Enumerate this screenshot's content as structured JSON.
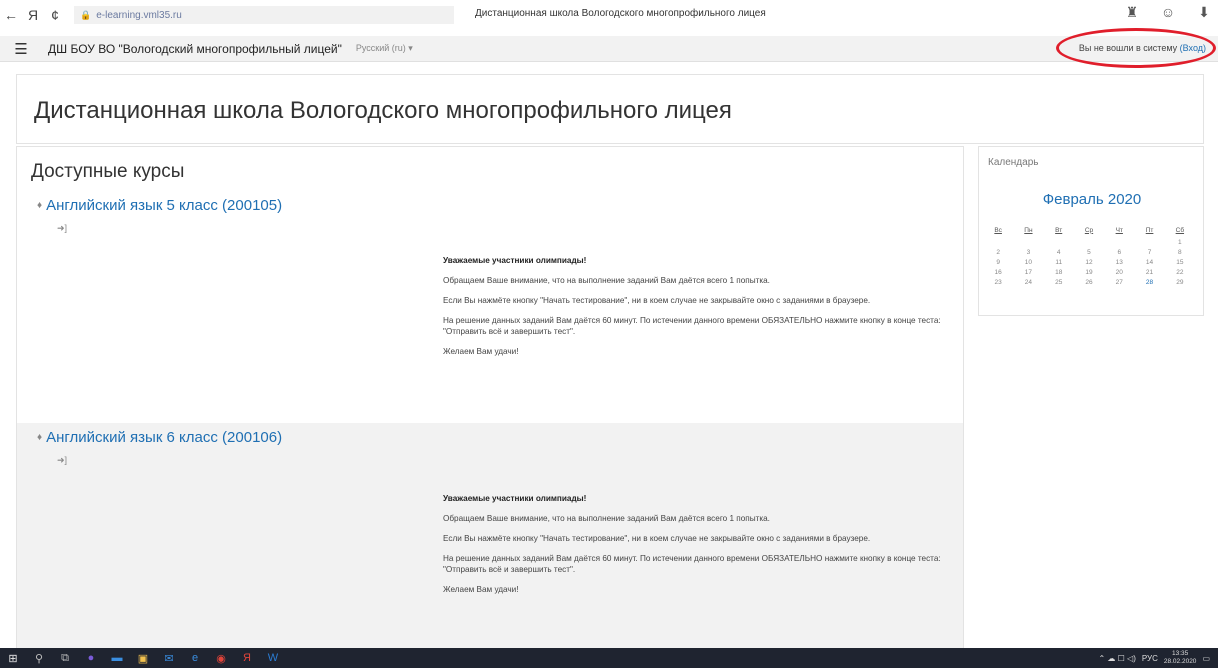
{
  "browser": {
    "back_icon": "←",
    "yandex_icon": "Я",
    "reload_icon": "¢",
    "url": "e-learning.vml35.ru",
    "tab_title": "Дистанционная школа Вологодского многопрофильного лицея",
    "bookmark_icon": "♜",
    "protect_icon": "☺",
    "download_icon": "⬇"
  },
  "navbar": {
    "site_name": "ДШ БОУ ВО \"Вологодский многопрофильный лицей\"",
    "language": "Русский (ru) ▾",
    "login_status": "Вы не вошли в систему",
    "login_link": "(Вход)"
  },
  "header": {
    "title": "Дистанционная школа Вологодского многопрофильного лицея"
  },
  "main": {
    "section_title": "Доступные курсы",
    "courses": [
      {
        "name": "Английский язык 5 класс (200105)",
        "summary_heading": "Уважаемые участники олимпиады!",
        "p1": "Обращаем Ваше внимание, что на выполнение заданий Вам даётся всего 1 попытка.",
        "p2": "Если Вы нажмёте кнопку \"Начать тестирование\", ни в коем случае не закрывайте окно с заданиями в браузере.",
        "p3": "На решение данных заданий Вам даётся 60 минут. По истечении данного времени ОБЯЗАТЕЛЬНО нажмите кнопку в конце теста: \"Отправить всё и завершить тест\".",
        "p4": "Желаем Вам удачи!"
      },
      {
        "name": "Английский язык 6 класс (200106)",
        "summary_heading": "Уважаемые участники олимпиады!",
        "p1": "Обращаем Ваше внимание, что на выполнение заданий Вам даётся всего 1 попытка.",
        "p2": "Если Вы нажмёте кнопку \"Начать тестирование\", ни в коем случае не закрывайте окно с заданиями в браузере.",
        "p3": "На решение данных заданий Вам даётся 60 минут. По истечении данного времени ОБЯЗАТЕЛЬНО нажмите кнопку в конце теста: \"Отправить всё и завершить тест\".",
        "p4": "Желаем Вам удачи!"
      }
    ]
  },
  "calendar": {
    "block_title": "Календарь",
    "month": "Февраль 2020",
    "weekdays": [
      "Вс",
      "Пн",
      "Вт",
      "Ср",
      "Чт",
      "Пт",
      "Сб"
    ],
    "weeks": [
      [
        "",
        "",
        "",
        "",
        "",
        "",
        "1"
      ],
      [
        "2",
        "3",
        "4",
        "5",
        "6",
        "7",
        "8"
      ],
      [
        "9",
        "10",
        "11",
        "12",
        "13",
        "14",
        "15"
      ],
      [
        "16",
        "17",
        "18",
        "19",
        "20",
        "21",
        "22"
      ],
      [
        "23",
        "24",
        "25",
        "26",
        "27",
        "28",
        "29"
      ]
    ],
    "today": "28",
    "link_color": "#1f6fb3"
  },
  "taskbar": {
    "tray_lang": "РУС",
    "tray_icons": "⌃ ☁ ☐ ◁)",
    "time": "13:35",
    "date": "28.02.2020"
  }
}
